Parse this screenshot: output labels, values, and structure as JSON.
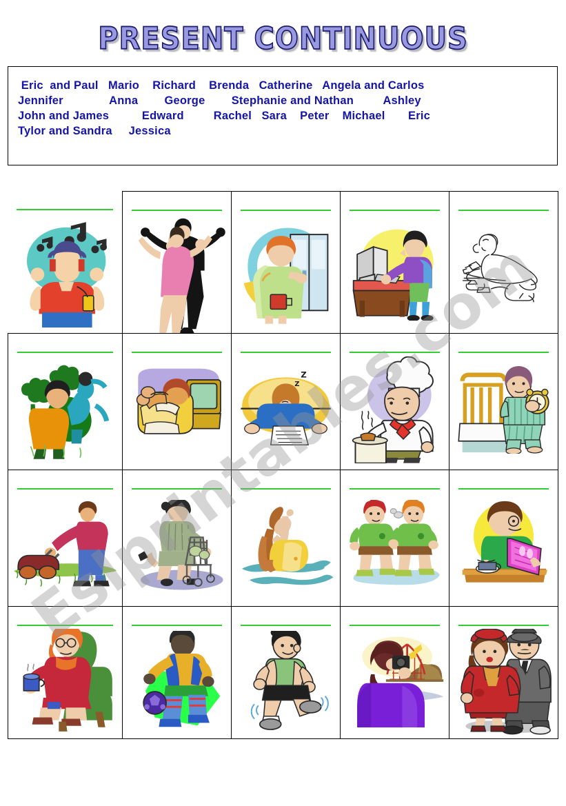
{
  "title": "PRESENT CONTINUOUS",
  "watermark": "Eslprintables.com",
  "colors": {
    "title_fill": "#9999e0",
    "title_outline": "#1a1a6e",
    "names_text": "#1414a8",
    "answer_line": "#33cc33",
    "table_border": "#000000"
  },
  "names_box": {
    "lines": [
      " Eric  and Paul   Mario    Richard    Brenda   Catherine   Angela and Carlos",
      "Jennifer              Anna        George        Stephanie and Nathan         Ashley",
      "John and James          Edward         Rachel   Sara    Peter    Michael       Eric",
      "Tylor and Sandra     Jessica"
    ],
    "names": [
      "Eric and Paul",
      "Mario",
      "Richard",
      "Brenda",
      "Catherine",
      "Angela and Carlos",
      "Jennifer",
      "Anna",
      "George",
      "Stephanie and Nathan",
      "Ashley",
      "John and James",
      "Edward",
      "Rachel",
      "Sara",
      "Peter",
      "Michael",
      "Eric",
      "Tylor and Sandra",
      "Jessica"
    ]
  },
  "grid": {
    "columns": 5,
    "rows": 4,
    "cells": [
      {
        "row": 1,
        "col": 1,
        "picture": "listening-to-music",
        "has_answer_line": true
      },
      {
        "row": 1,
        "col": 2,
        "picture": "dancing-couple",
        "has_answer_line": true
      },
      {
        "row": 1,
        "col": 3,
        "picture": "opening-fridge",
        "has_answer_line": true
      },
      {
        "row": 1,
        "col": 4,
        "picture": "using-computer",
        "has_answer_line": true
      },
      {
        "row": 1,
        "col": 5,
        "picture": "doing-homework",
        "has_answer_line": true
      },
      {
        "row": 2,
        "col": 1,
        "picture": "planting-gardening",
        "has_answer_line": true
      },
      {
        "row": 2,
        "col": 2,
        "picture": "watching-tv",
        "has_answer_line": true
      },
      {
        "row": 2,
        "col": 3,
        "picture": "sleeping-at-desk",
        "has_answer_line": true
      },
      {
        "row": 2,
        "col": 4,
        "picture": "cooking-chef",
        "has_answer_line": true
      },
      {
        "row": 2,
        "col": 5,
        "picture": "waking-up-alarm-clock",
        "has_answer_line": true
      },
      {
        "row": 3,
        "col": 1,
        "picture": "mowing-the-lawn",
        "has_answer_line": true
      },
      {
        "row": 3,
        "col": 2,
        "picture": "shopping-cart",
        "has_answer_line": true
      },
      {
        "row": 3,
        "col": 3,
        "picture": "swimming",
        "has_answer_line": true
      },
      {
        "row": 3,
        "col": 4,
        "picture": "two-boys-running",
        "has_answer_line": true
      },
      {
        "row": 3,
        "col": 5,
        "picture": "reading-a-book",
        "has_answer_line": true
      },
      {
        "row": 4,
        "col": 1,
        "picture": "drinking-tea",
        "has_answer_line": true
      },
      {
        "row": 4,
        "col": 2,
        "picture": "playing-football",
        "has_answer_line": true
      },
      {
        "row": 4,
        "col": 3,
        "picture": "jogging",
        "has_answer_line": true
      },
      {
        "row": 4,
        "col": 4,
        "picture": "taking-a-photo",
        "has_answer_line": true
      },
      {
        "row": 4,
        "col": 5,
        "picture": "walking-couple",
        "has_answer_line": true
      }
    ]
  },
  "sleeping_zzz": "Z"
}
